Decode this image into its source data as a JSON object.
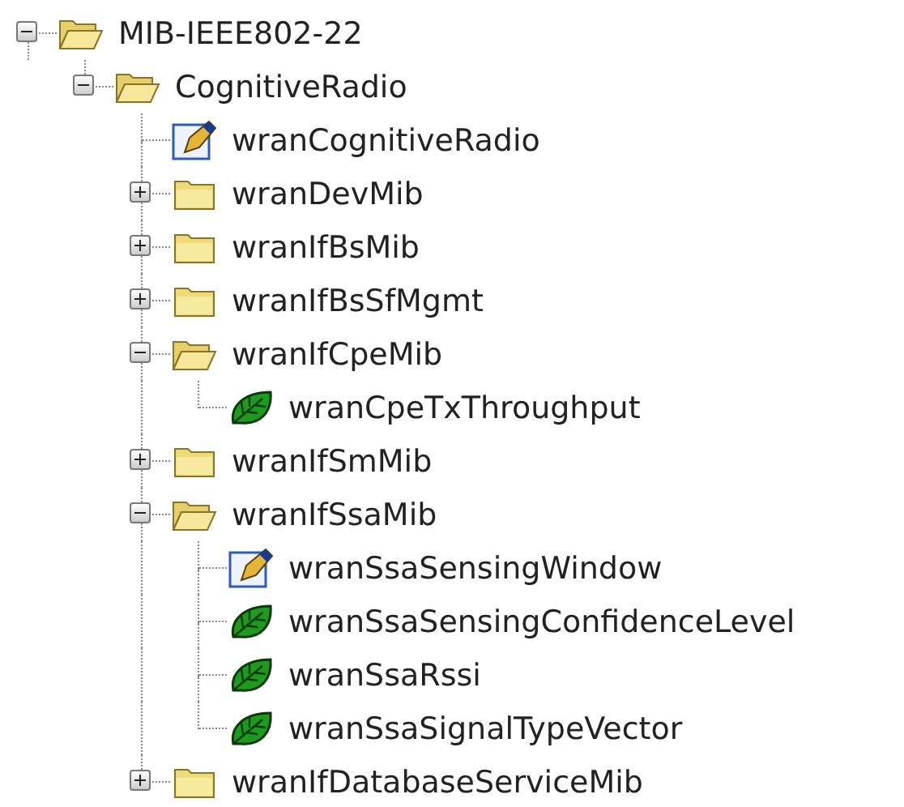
{
  "tree": [
    {
      "label": "MIB-IEEE802-22",
      "kind": "folder",
      "expanded": true,
      "children": [
        {
          "label": "CognitiveRadio",
          "kind": "folder",
          "expanded": true,
          "children": [
            {
              "label": "wranCognitiveRadio",
              "kind": "editable"
            },
            {
              "label": "wranDevMib",
              "kind": "folder",
              "expanded": false
            },
            {
              "label": "wranIfBsMib",
              "kind": "folder",
              "expanded": false
            },
            {
              "label": "wranIfBsSfMgmt",
              "kind": "folder",
              "expanded": false
            },
            {
              "label": "wranIfCpeMib",
              "kind": "folder",
              "expanded": true,
              "children": [
                {
                  "label": "wranCpeTxThroughput",
                  "kind": "leaf"
                }
              ]
            },
            {
              "label": "wranIfSmMib",
              "kind": "folder",
              "expanded": false
            },
            {
              "label": "wranIfSsaMib",
              "kind": "folder",
              "expanded": true,
              "children": [
                {
                  "label": "wranSsaSensingWindow",
                  "kind": "editable"
                },
                {
                  "label": "wranSsaSensingConfidenceLevel",
                  "kind": "leaf"
                },
                {
                  "label": "wranSsaRssi",
                  "kind": "leaf"
                },
                {
                  "label": "wranSsaSignalTypeVector",
                  "kind": "leaf"
                }
              ]
            },
            {
              "label": "wranIfDatabaseServiceMib",
              "kind": "folder",
              "expanded": false
            }
          ]
        }
      ]
    }
  ]
}
